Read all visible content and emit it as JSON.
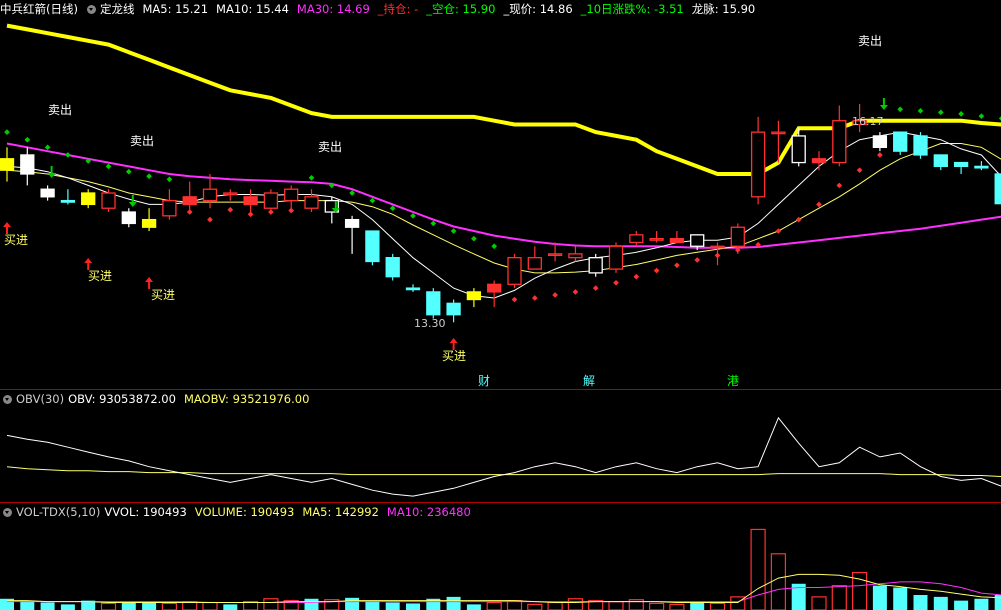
{
  "main_header": {
    "stock_name": "中兵红箭(日线)",
    "indicator_name": "定龙线",
    "ma5": "MA5: 15.21",
    "ma10": "MA10: 15.44",
    "ma30": "MA30: 14.69",
    "hold": "_持仓: -",
    "empty": "_空仓: 15.90",
    "price": "_现价: 14.86",
    "change10": "_10日涨跌%: -3.51",
    "longmai": "龙脉: 15.90"
  },
  "signals": {
    "buy_label": "买进",
    "sell_label": "卖出"
  },
  "annotations": {
    "low_label": "13.30",
    "high_label": "16.17"
  },
  "events": [
    "财",
    "解",
    "港"
  ],
  "obv_header": {
    "name": "OBV(30)",
    "obv": "OBV: 93053872.00",
    "maobv": "MAOBV: 93521976.00"
  },
  "vol_header": {
    "name": "VOL-TDX(5,10)",
    "vvol": "VVOL: 190493",
    "volume": "VOLUME: 190493",
    "ma5": "MA5: 142992",
    "ma10": "MA10: 236480"
  },
  "colors": {
    "up": "#ff3030",
    "down": "#54ffff",
    "ma5": "#ffffff",
    "ma10": "#ffff66",
    "ma30": "#ff30ff",
    "longmai": "#ffff00",
    "hold_green": "#00ff00",
    "sell_green": "#00cc00",
    "sep": "#b00000"
  },
  "chart_data": {
    "type": "candlestick",
    "price_range": [
      12.7,
      17.3
    ],
    "candles": [
      {
        "o": 15.45,
        "c": 15.3,
        "h": 15.6,
        "l": 15.15,
        "fill": "yellow"
      },
      {
        "o": 15.5,
        "c": 15.25,
        "h": 15.6,
        "l": 15.1,
        "fill": "white"
      },
      {
        "o": 15.05,
        "c": 14.95,
        "h": 15.1,
        "l": 14.9,
        "fill": "white"
      },
      {
        "o": 14.9,
        "c": 14.88,
        "h": 15.05,
        "l": 14.85,
        "fill": "cyan"
      },
      {
        "o": 15.0,
        "c": 14.85,
        "h": 15.05,
        "l": 14.8,
        "fill": "yellow"
      },
      {
        "o": 14.8,
        "c": 15.0,
        "h": 15.05,
        "l": 14.75,
        "fill": "hollow"
      },
      {
        "o": 14.75,
        "c": 14.6,
        "h": 14.8,
        "l": 14.55,
        "fill": "white"
      },
      {
        "o": 14.65,
        "c": 14.55,
        "h": 14.8,
        "l": 14.5,
        "fill": "yellow"
      },
      {
        "o": 14.7,
        "c": 14.9,
        "h": 15.05,
        "l": 14.65,
        "fill": "hollow"
      },
      {
        "o": 14.85,
        "c": 14.95,
        "h": 15.15,
        "l": 14.75,
        "fill": "solid"
      },
      {
        "o": 14.9,
        "c": 15.05,
        "h": 15.25,
        "l": 14.8,
        "fill": "hollow"
      },
      {
        "o": 15.0,
        "c": 15.0,
        "h": 15.05,
        "l": 14.9,
        "fill": "doji"
      },
      {
        "o": 14.85,
        "c": 14.95,
        "h": 15.05,
        "l": 14.75,
        "fill": "solid"
      },
      {
        "o": 14.8,
        "c": 15.0,
        "h": 15.05,
        "l": 14.75,
        "fill": "hollow"
      },
      {
        "o": 14.9,
        "c": 15.05,
        "h": 15.1,
        "l": 14.8,
        "fill": "hollow"
      },
      {
        "o": 14.95,
        "c": 14.8,
        "h": 15.05,
        "l": 14.75,
        "fill": "hollow"
      },
      {
        "o": 14.9,
        "c": 14.75,
        "h": 14.95,
        "l": 14.6,
        "fill": "hollow_down"
      },
      {
        "o": 14.65,
        "c": 14.55,
        "h": 14.7,
        "l": 14.2,
        "fill": "white"
      },
      {
        "o": 14.5,
        "c": 14.1,
        "h": 14.5,
        "l": 14.05,
        "fill": "cyan"
      },
      {
        "o": 14.15,
        "c": 13.9,
        "h": 14.2,
        "l": 13.85,
        "fill": "cyan"
      },
      {
        "o": 13.75,
        "c": 13.75,
        "h": 13.8,
        "l": 13.7,
        "fill": "cyan"
      },
      {
        "o": 13.7,
        "c": 13.4,
        "h": 13.75,
        "l": 13.35,
        "fill": "cyan"
      },
      {
        "o": 13.55,
        "c": 13.4,
        "h": 13.6,
        "l": 13.3,
        "fill": "cyan"
      },
      {
        "o": 13.6,
        "c": 13.7,
        "h": 13.75,
        "l": 13.5,
        "fill": "yellow"
      },
      {
        "o": 13.7,
        "c": 13.8,
        "h": 13.85,
        "l": 13.5,
        "fill": "solid"
      },
      {
        "o": 13.8,
        "c": 14.15,
        "h": 14.2,
        "l": 13.75,
        "fill": "hollow"
      },
      {
        "o": 14.0,
        "c": 14.15,
        "h": 14.3,
        "l": 14.0,
        "fill": "hollow"
      },
      {
        "o": 14.2,
        "c": 14.2,
        "h": 14.35,
        "l": 14.1,
        "fill": "doji"
      },
      {
        "o": 14.15,
        "c": 14.2,
        "h": 14.3,
        "l": 14.1,
        "fill": "hollow"
      },
      {
        "o": 13.95,
        "c": 14.15,
        "h": 14.2,
        "l": 13.9,
        "fill": "white_hollow"
      },
      {
        "o": 14.0,
        "c": 14.3,
        "h": 14.35,
        "l": 13.95,
        "fill": "hollow"
      },
      {
        "o": 14.35,
        "c": 14.45,
        "h": 14.5,
        "l": 14.3,
        "fill": "hollow"
      },
      {
        "o": 14.4,
        "c": 14.4,
        "h": 14.5,
        "l": 14.35,
        "fill": "doji"
      },
      {
        "o": 14.35,
        "c": 14.4,
        "h": 14.5,
        "l": 14.35,
        "fill": "solid"
      },
      {
        "o": 14.3,
        "c": 14.45,
        "h": 14.45,
        "l": 14.25,
        "fill": "white_hollow"
      },
      {
        "o": 14.3,
        "c": 14.3,
        "h": 14.35,
        "l": 14.05,
        "fill": "doji"
      },
      {
        "o": 14.3,
        "c": 14.55,
        "h": 14.6,
        "l": 14.2,
        "fill": "hollow"
      },
      {
        "o": 14.95,
        "c": 15.8,
        "h": 16.0,
        "l": 14.85,
        "fill": "hollow"
      },
      {
        "o": 15.8,
        "c": 15.8,
        "h": 15.95,
        "l": 15.4,
        "fill": "doji"
      },
      {
        "o": 15.75,
        "c": 15.4,
        "h": 15.85,
        "l": 15.35,
        "fill": "hollow_down"
      },
      {
        "o": 15.4,
        "c": 15.45,
        "h": 15.55,
        "l": 15.3,
        "fill": "solid"
      },
      {
        "o": 15.4,
        "c": 15.95,
        "h": 16.15,
        "l": 15.35,
        "fill": "hollow"
      },
      {
        "o": 15.9,
        "c": 15.95,
        "h": 16.17,
        "l": 15.8,
        "fill": "hollow"
      },
      {
        "o": 15.75,
        "c": 15.6,
        "h": 15.8,
        "l": 15.55,
        "fill": "white"
      },
      {
        "o": 15.8,
        "c": 15.55,
        "h": 15.8,
        "l": 15.5,
        "fill": "cyan"
      },
      {
        "o": 15.75,
        "c": 15.5,
        "h": 15.8,
        "l": 15.45,
        "fill": "cyan"
      },
      {
        "o": 15.5,
        "c": 15.35,
        "h": 15.5,
        "l": 15.3,
        "fill": "cyan"
      },
      {
        "o": 15.4,
        "c": 15.35,
        "h": 15.4,
        "l": 15.25,
        "fill": "cyan"
      },
      {
        "o": 15.35,
        "c": 15.33,
        "h": 15.42,
        "l": 15.3,
        "fill": "cyan"
      },
      {
        "o": 15.25,
        "c": 14.86,
        "h": 15.25,
        "l": 14.8,
        "fill": "cyan"
      }
    ],
    "ma5": [
      15.35,
      15.33,
      15.28,
      15.2,
      15.1,
      15.0,
      14.92,
      14.85,
      14.85,
      14.88,
      14.95,
      14.98,
      14.98,
      14.97,
      14.98,
      14.98,
      14.95,
      14.85,
      14.65,
      14.4,
      14.15,
      13.95,
      13.75,
      13.65,
      13.62,
      13.72,
      13.88,
      14.0,
      14.1,
      14.15,
      14.18,
      14.22,
      14.28,
      14.35,
      14.38,
      14.38,
      14.42,
      14.6,
      14.85,
      15.1,
      15.35,
      15.55,
      15.7,
      15.75,
      15.8,
      15.75,
      15.7,
      15.58,
      15.5,
      15.21
    ],
    "ma10": [
      15.3,
      15.28,
      15.25,
      15.2,
      15.15,
      15.08,
      15.0,
      14.95,
      14.9,
      14.88,
      14.88,
      14.88,
      14.88,
      14.88,
      14.9,
      14.9,
      14.9,
      14.88,
      14.82,
      14.72,
      14.58,
      14.45,
      14.32,
      14.2,
      14.08,
      14.0,
      13.95,
      13.95,
      13.96,
      13.98,
      14.02,
      14.06,
      14.12,
      14.18,
      14.22,
      14.26,
      14.3,
      14.4,
      14.5,
      14.65,
      14.8,
      14.95,
      15.12,
      15.3,
      15.45,
      15.55,
      15.65,
      15.65,
      15.6,
      15.44
    ],
    "ma30": [
      15.65,
      15.6,
      15.55,
      15.5,
      15.45,
      15.4,
      15.35,
      15.3,
      15.25,
      15.22,
      15.2,
      15.18,
      15.17,
      15.16,
      15.15,
      15.14,
      15.12,
      15.05,
      14.95,
      14.85,
      14.75,
      14.65,
      14.56,
      14.5,
      14.44,
      14.4,
      14.36,
      14.33,
      14.31,
      14.3,
      14.3,
      14.3,
      14.3,
      14.29,
      14.28,
      14.28,
      14.28,
      14.29,
      14.32,
      14.35,
      14.38,
      14.41,
      14.44,
      14.47,
      14.5,
      14.53,
      14.57,
      14.61,
      14.65,
      14.69
    ],
    "longmai": [
      17.2,
      17.15,
      17.1,
      17.05,
      17.0,
      16.95,
      16.85,
      16.75,
      16.65,
      16.55,
      16.45,
      16.35,
      16.3,
      16.25,
      16.15,
      16.05,
      16.0,
      16.0,
      16.0,
      16.0,
      16.0,
      16.0,
      16.0,
      16.0,
      15.95,
      15.9,
      15.9,
      15.9,
      15.9,
      15.8,
      15.75,
      15.7,
      15.55,
      15.45,
      15.35,
      15.25,
      15.25,
      15.25,
      15.4,
      15.85,
      15.85,
      15.85,
      15.95,
      15.95,
      15.95,
      15.95,
      15.95,
      15.95,
      15.92,
      15.9
    ],
    "sar": [
      {
        "i": 0,
        "v": 15.8,
        "c": "green"
      },
      {
        "i": 1,
        "v": 15.7,
        "c": "green"
      },
      {
        "i": 2,
        "v": 15.6,
        "c": "green"
      },
      {
        "i": 3,
        "v": 15.5,
        "c": "green"
      },
      {
        "i": 4,
        "v": 15.42,
        "c": "green"
      },
      {
        "i": 5,
        "v": 15.35,
        "c": "green"
      },
      {
        "i": 6,
        "v": 15.28,
        "c": "green"
      },
      {
        "i": 7,
        "v": 15.22,
        "c": "green"
      },
      {
        "i": 8,
        "v": 15.18,
        "c": "green"
      },
      {
        "i": 9,
        "v": 14.75,
        "c": "red"
      },
      {
        "i": 10,
        "v": 14.65,
        "c": "red"
      },
      {
        "i": 11,
        "v": 14.78,
        "c": "red"
      },
      {
        "i": 12,
        "v": 14.72,
        "c": "red"
      },
      {
        "i": 13,
        "v": 14.75,
        "c": "red"
      },
      {
        "i": 14,
        "v": 14.77,
        "c": "red"
      },
      {
        "i": 15,
        "v": 15.2,
        "c": "green"
      },
      {
        "i": 16,
        "v": 15.1,
        "c": "green"
      },
      {
        "i": 17,
        "v": 15.0,
        "c": "green"
      },
      {
        "i": 18,
        "v": 14.9,
        "c": "green"
      },
      {
        "i": 19,
        "v": 14.8,
        "c": "green"
      },
      {
        "i": 20,
        "v": 14.7,
        "c": "green"
      },
      {
        "i": 21,
        "v": 14.6,
        "c": "green"
      },
      {
        "i": 22,
        "v": 14.5,
        "c": "green"
      },
      {
        "i": 23,
        "v": 14.4,
        "c": "green"
      },
      {
        "i": 24,
        "v": 14.3,
        "c": "green"
      },
      {
        "i": 25,
        "v": 13.6,
        "c": "red"
      },
      {
        "i": 26,
        "v": 13.62,
        "c": "red"
      },
      {
        "i": 27,
        "v": 13.66,
        "c": "red"
      },
      {
        "i": 28,
        "v": 13.7,
        "c": "red"
      },
      {
        "i": 29,
        "v": 13.75,
        "c": "red"
      },
      {
        "i": 30,
        "v": 13.82,
        "c": "red"
      },
      {
        "i": 31,
        "v": 13.9,
        "c": "red"
      },
      {
        "i": 32,
        "v": 13.98,
        "c": "red"
      },
      {
        "i": 33,
        "v": 14.05,
        "c": "red"
      },
      {
        "i": 34,
        "v": 14.12,
        "c": "red"
      },
      {
        "i": 35,
        "v": 14.18,
        "c": "red"
      },
      {
        "i": 36,
        "v": 14.25,
        "c": "red"
      },
      {
        "i": 37,
        "v": 14.32,
        "c": "red"
      },
      {
        "i": 38,
        "v": 14.5,
        "c": "red"
      },
      {
        "i": 39,
        "v": 14.65,
        "c": "red"
      },
      {
        "i": 40,
        "v": 14.85,
        "c": "red"
      },
      {
        "i": 41,
        "v": 15.1,
        "c": "red"
      },
      {
        "i": 42,
        "v": 15.3,
        "c": "red"
      },
      {
        "i": 43,
        "v": 15.5,
        "c": "red"
      },
      {
        "i": 44,
        "v": 16.1,
        "c": "green"
      },
      {
        "i": 45,
        "v": 16.08,
        "c": "green"
      },
      {
        "i": 46,
        "v": 16.06,
        "c": "green"
      },
      {
        "i": 47,
        "v": 16.04,
        "c": "green"
      },
      {
        "i": 48,
        "v": 16.01,
        "c": "green"
      },
      {
        "i": 49,
        "v": 15.98,
        "c": "green"
      }
    ],
    "buy_signals": [
      0,
      4,
      7,
      22
    ],
    "sell_signals": [
      2,
      6,
      16,
      43
    ],
    "sell_text_signals": [
      {
        "i": 2,
        "v": 16.35
      },
      {
        "i": 6,
        "v": 15.9
      },
      {
        "i": 16,
        "v": 15.87
      },
      {
        "i": 43,
        "v": 16.9
      }
    ],
    "event_markers": [
      {
        "label_index": 0,
        "i": 24
      },
      {
        "label_index": 1,
        "i": 29
      },
      {
        "label_index": 2,
        "i": 36
      }
    ],
    "obv": [
      62,
      58,
      55,
      50,
      45,
      40,
      36,
      30,
      26,
      22,
      18,
      14,
      18,
      22,
      18,
      14,
      18,
      12,
      6,
      2,
      0,
      4,
      8,
      14,
      20,
      24,
      30,
      34,
      30,
      24,
      30,
      34,
      28,
      24,
      30,
      34,
      28,
      30,
      80,
      54,
      30,
      34,
      50,
      40,
      44,
      30,
      20,
      16,
      18,
      10
    ],
    "maobv": [
      30,
      28,
      27,
      26,
      26,
      25,
      25,
      24,
      24,
      24,
      23,
      23,
      23,
      23,
      23,
      23,
      23,
      22,
      22,
      22,
      22,
      22,
      22,
      22,
      22,
      22,
      22,
      22,
      22,
      22,
      22,
      22,
      22,
      22,
      22,
      22,
      22,
      22,
      23,
      23,
      23,
      23,
      23,
      23,
      22,
      22,
      22,
      21,
      21,
      20
    ],
    "obv_range": [
      -5,
      90
    ],
    "volume": [
      {
        "v": 12,
        "up": false
      },
      {
        "v": 10,
        "up": false
      },
      {
        "v": 8,
        "up": false
      },
      {
        "v": 6,
        "up": false
      },
      {
        "v": 10,
        "up": false
      },
      {
        "v": 7,
        "up": true
      },
      {
        "v": 9,
        "up": false
      },
      {
        "v": 8,
        "up": false
      },
      {
        "v": 7,
        "up": true
      },
      {
        "v": 9,
        "up": true
      },
      {
        "v": 8,
        "up": true
      },
      {
        "v": 6,
        "up": false
      },
      {
        "v": 9,
        "up": true
      },
      {
        "v": 12,
        "up": true
      },
      {
        "v": 10,
        "up": true
      },
      {
        "v": 12,
        "up": false
      },
      {
        "v": 11,
        "up": true
      },
      {
        "v": 13,
        "up": false
      },
      {
        "v": 10,
        "up": false
      },
      {
        "v": 8,
        "up": false
      },
      {
        "v": 7,
        "up": false
      },
      {
        "v": 12,
        "up": false
      },
      {
        "v": 14,
        "up": false
      },
      {
        "v": 6,
        "up": false
      },
      {
        "v": 8,
        "up": true
      },
      {
        "v": 10,
        "up": true
      },
      {
        "v": 6,
        "up": true
      },
      {
        "v": 8,
        "up": true
      },
      {
        "v": 12,
        "up": true
      },
      {
        "v": 10,
        "up": true
      },
      {
        "v": 9,
        "up": true
      },
      {
        "v": 11,
        "up": true
      },
      {
        "v": 7,
        "up": true
      },
      {
        "v": 6,
        "up": true
      },
      {
        "v": 8,
        "up": false
      },
      {
        "v": 7,
        "up": true
      },
      {
        "v": 14,
        "up": true
      },
      {
        "v": 86,
        "up": true
      },
      {
        "v": 60,
        "up": true
      },
      {
        "v": 28,
        "up": false
      },
      {
        "v": 14,
        "up": true
      },
      {
        "v": 26,
        "up": true
      },
      {
        "v": 40,
        "up": true
      },
      {
        "v": 26,
        "up": false
      },
      {
        "v": 24,
        "up": false
      },
      {
        "v": 16,
        "up": false
      },
      {
        "v": 14,
        "up": false
      },
      {
        "v": 10,
        "up": false
      },
      {
        "v": 12,
        "up": false
      },
      {
        "v": 16,
        "up": false
      }
    ],
    "vol_ma5": [
      10,
      10,
      9,
      9,
      9,
      8,
      8,
      8,
      8,
      8,
      8,
      8,
      8,
      8,
      9,
      9,
      9,
      10,
      10,
      10,
      10,
      10,
      10,
      10,
      10,
      10,
      9,
      8,
      8,
      9,
      9,
      9,
      9,
      8,
      8,
      8,
      8,
      23,
      34,
      38,
      38,
      37,
      33,
      27,
      25,
      22,
      20,
      17,
      14,
      13
    ],
    "vol_ma10": [
      9,
      9,
      9,
      9,
      9,
      9,
      9,
      9,
      9,
      9,
      8,
      8,
      8,
      8,
      8,
      8,
      9,
      9,
      9,
      9,
      9,
      9,
      9,
      9,
      9,
      9,
      9,
      9,
      9,
      9,
      9,
      9,
      9,
      9,
      9,
      9,
      9,
      16,
      22,
      24,
      24,
      25,
      26,
      28,
      30,
      30,
      28,
      24,
      18,
      16
    ],
    "vol_range": [
      0,
      95
    ]
  }
}
